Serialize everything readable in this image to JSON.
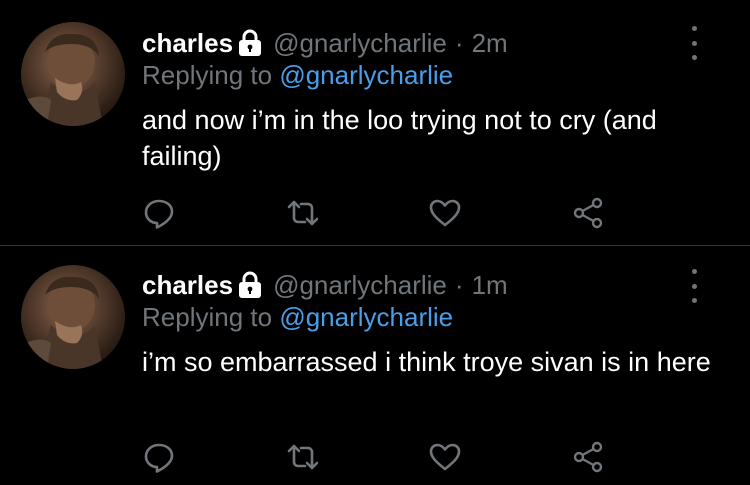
{
  "tweets": [
    {
      "display_name": "charles",
      "handle": "@gnarlycharlie",
      "separator": "·",
      "time": "2m",
      "replying_prefix": "Replying to",
      "replying_handle": "@gnarlycharlie",
      "text": "and now i’m in the loo trying not to cry (and failing)"
    },
    {
      "display_name": "charles",
      "handle": "@gnarlycharlie",
      "separator": "·",
      "time": "1m",
      "replying_prefix": "Replying to",
      "replying_handle": "@gnarlycharlie",
      "text": "i’m so embarrassed i think troye sivan is in here"
    }
  ],
  "icons": {
    "protected": "lock-icon",
    "more": "more-vertical-icon",
    "reply": "reply-icon",
    "retweet": "retweet-icon",
    "like": "heart-icon",
    "share": "share-icon"
  },
  "colors": {
    "background": "#000000",
    "primary_text": "#ffffff",
    "secondary_text": "#71767b",
    "link": "#4a9eea",
    "divider": "#2f3336"
  }
}
